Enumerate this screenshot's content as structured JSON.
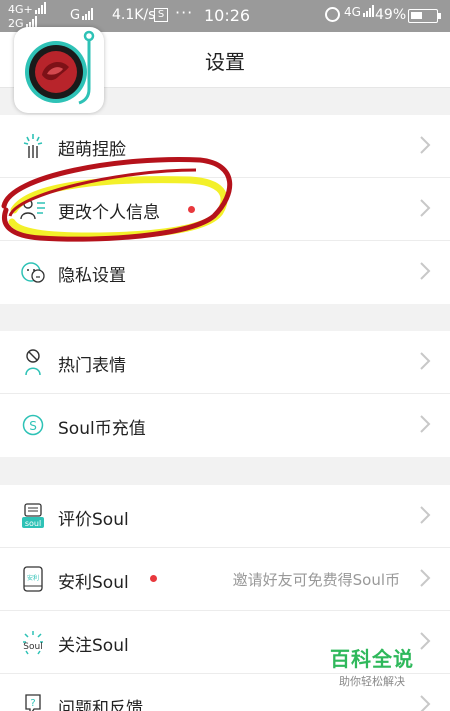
{
  "status_bar": {
    "network_top": "4G+",
    "network_bottom": "2G",
    "network_mid": "G",
    "speed": "4.1K/s",
    "s_badge": "S",
    "dots": "···",
    "time": "10:26",
    "network_right": "4G",
    "battery": "49%",
    "battery_level": 0.49
  },
  "header": {
    "title": "设置"
  },
  "logo": {
    "icon": "soul-app-logo-icon"
  },
  "groups": [
    [
      {
        "icon": "face-pinch-icon",
        "label": "超萌捏脸"
      },
      {
        "icon": "profile-edit-icon",
        "label": "更改个人信息",
        "badge": true
      },
      {
        "icon": "privacy-face-icon",
        "label": "隐私设置"
      }
    ],
    [
      {
        "icon": "sticker-icon",
        "label": "热门表情"
      },
      {
        "icon": "coin-icon",
        "label": "Soul币充值"
      }
    ],
    [
      {
        "icon": "rate-icon",
        "label": "评价Soul"
      },
      {
        "icon": "share-icon",
        "label": "安利Soul",
        "badge": true,
        "hint": "邀请好友可免费得Soul币"
      },
      {
        "icon": "follow-icon",
        "label": "关注Soul"
      },
      {
        "icon": "help-icon",
        "label": "问题和反馈"
      }
    ]
  ],
  "watermark": {
    "title": "百科全说",
    "subtitle": "助你轻松解决"
  },
  "colors": {
    "accent": "#2ec2b6",
    "badge": "#e8383d",
    "annotation_red": "#b5121b",
    "annotation_yellow": "#f3f02a"
  }
}
